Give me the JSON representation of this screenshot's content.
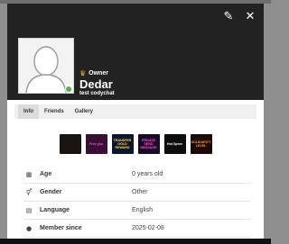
{
  "header": {
    "edit_icon": "pencil-square-icon",
    "close_icon": "close-icon",
    "edit_glyph": "✎",
    "close_glyph": "✕"
  },
  "profile": {
    "rank": "Owner",
    "rank_icon": "crown-icon",
    "username": "Dedar",
    "motto": "test codychat",
    "status": "online"
  },
  "tabs": [
    {
      "label": "Info",
      "active": true
    },
    {
      "label": "Friends",
      "active": false
    },
    {
      "label": "Gallery",
      "active": false
    }
  ],
  "gifts": [
    {
      "label": "",
      "bg": "#1a1410",
      "fg": "#e85a7a"
    },
    {
      "label": "Free you",
      "bg": "#3a0f35",
      "fg": "#ff4fd8"
    },
    {
      "label": "TRANSFER GOLD REWARD",
      "bg": "#0b1630",
      "fg": "#ffd84a"
    },
    {
      "label": "PRIVATE SEND MESSAGE",
      "bg": "#160b2a",
      "fg": "#ff55c8"
    },
    {
      "label": "Hot Spree",
      "bg": "#0d0d0d",
      "fg": "#ffffff"
    },
    {
      "label": "SOLIDARITY LEVEL",
      "bg": "#1c0a0a",
      "fg": "#f0a030"
    }
  ],
  "info_rows": [
    {
      "icon": "calendar-icon",
      "glyph": "▦",
      "label": "Age",
      "value": "0 years old"
    },
    {
      "icon": "gender-icon",
      "glyph": "⚥",
      "label": "Gender",
      "value": "Other"
    },
    {
      "icon": "language-icon",
      "glyph": "▤",
      "label": "Language",
      "value": "English"
    },
    {
      "icon": "user-icon",
      "glyph": "●",
      "label": "Member since",
      "value": "2025-02-08"
    }
  ],
  "colors": {
    "header_bg": "#222222",
    "online": "#4bb543",
    "crown": "#f3b21a"
  }
}
